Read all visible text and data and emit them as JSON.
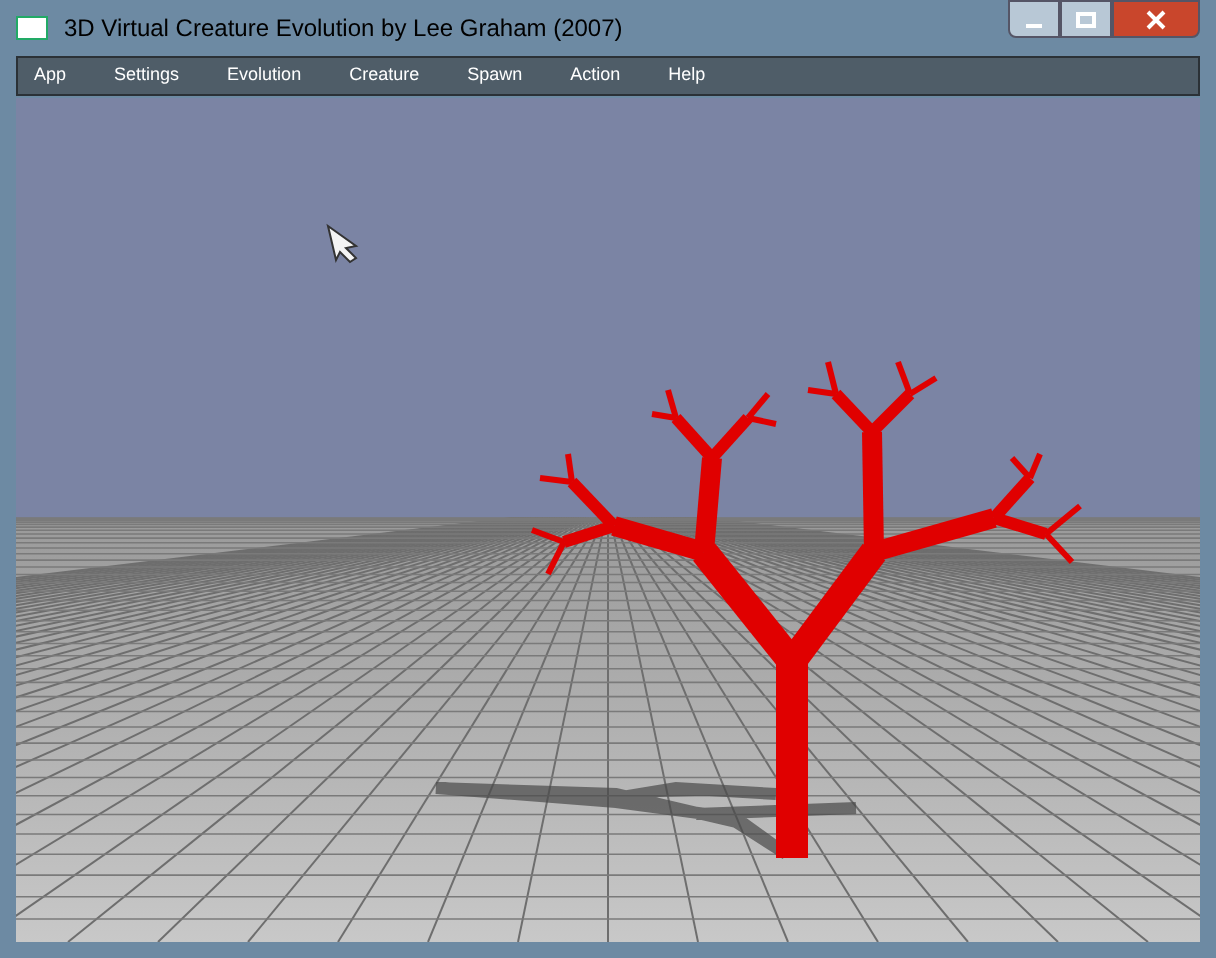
{
  "window": {
    "title": "3D Virtual Creature Evolution by Lee Graham (2007)"
  },
  "menu": [
    "App",
    "Settings",
    "Evolution",
    "Creature",
    "Spawn",
    "Action",
    "Help"
  ]
}
